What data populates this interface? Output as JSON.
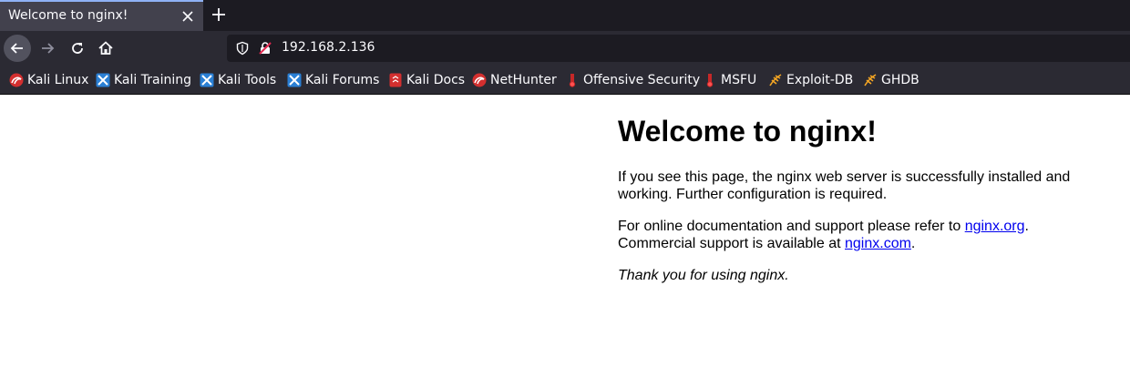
{
  "tab": {
    "title": "Welcome to nginx!"
  },
  "navbar": {
    "url": "192.168.2.136"
  },
  "bookmarks": [
    {
      "label": "Kali Linux",
      "icon": "kali-dragon-icon"
    },
    {
      "label": "Kali Training",
      "icon": "kali-training-icon"
    },
    {
      "label": "Kali Tools",
      "icon": "kali-tools-icon"
    },
    {
      "label": "Kali Forums",
      "icon": "kali-forums-icon"
    },
    {
      "label": "Kali Docs",
      "icon": "kali-docs-icon"
    },
    {
      "label": "NetHunter",
      "icon": "nethunter-icon"
    },
    {
      "label": "Offensive Security",
      "icon": "offsec-icon"
    },
    {
      "label": "MSFU",
      "icon": "msfu-icon"
    },
    {
      "label": "Exploit-DB",
      "icon": "exploit-db-icon"
    },
    {
      "label": "GHDB",
      "icon": "ghdb-icon"
    }
  ],
  "page": {
    "heading": "Welcome to nginx!",
    "para1": "If you see this page, the nginx web server is successfully installed and working. Further configuration is required.",
    "para2_prefix": "For online documentation and support please refer to ",
    "para2_link": "nginx.org",
    "para2_mid": ".",
    "para2_line2_prefix": "Commercial support is available at ",
    "para2_link2": "nginx.com",
    "para2_suffix": ".",
    "para3": "Thank you for using nginx."
  },
  "colors": {
    "tabstrip_bg": "#1c1b22",
    "toolbar_bg": "#2b2a33",
    "active_tab_bg": "#42414d",
    "link": "#0000ee"
  }
}
